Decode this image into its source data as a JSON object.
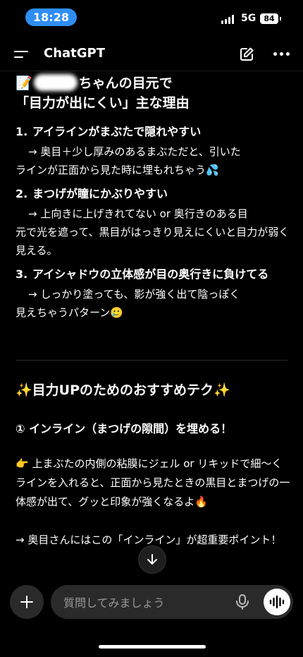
{
  "status": {
    "time": "18:28",
    "network": "5G",
    "battery": "84"
  },
  "header": {
    "title": "ChatGPT"
  },
  "message": {
    "heading_emoji": "📝",
    "heading_line1_suffix": "ちゃんの目元で",
    "heading_line2": "「目力が出にくい」主な理由",
    "reasons": [
      {
        "num": "1.",
        "title": "アイラインがまぶたで隠れやすい",
        "body_lead": "→ 奥目＋少し厚みのあるまぶただと、引いた",
        "body_rest": "ラインが正面から見た時に埋もれちゃう💦"
      },
      {
        "num": "2.",
        "title": "まつげが瞳にかぶりやすい",
        "body_lead": "→ 上向きに上げきれてない or 奥行きのある目",
        "body_rest": "元で光を遮って、黒目がはっきり見えにくいと目力が弱く見える。"
      },
      {
        "num": "3.",
        "title": "アイシャドウの立体感が目の奥行きに負けてる",
        "body_lead": "→ しっかり塗っても、影が強く出て陰っぽく",
        "body_rest": "見えちゃうパターン🥲"
      }
    ],
    "tips_heading": "✨目力UPのためのおすすめテク✨",
    "tip1_title": "① インライン（まつげの隙間）を埋める！",
    "tip1_body": "👉 上まぶたの内側の粘膜にジェル or リキッドで細〜くラインを入れると、正面から見たときの黒目とまつげの一体感が出て、グッと印象が強くなるよ🔥",
    "tip1_note": "→ 奥目さんにはこの「インライン」が超重要ポイント！"
  },
  "composer": {
    "placeholder": "質問してみましょう"
  },
  "colors": {
    "accent": "#2f8ef5",
    "background": "#000000",
    "input_bg": "#2a2a2a"
  },
  "icons": [
    "menu-icon",
    "compose-icon",
    "more-icon",
    "arrow-down-icon",
    "plus-icon",
    "mic-icon",
    "voice-wave-icon"
  ]
}
